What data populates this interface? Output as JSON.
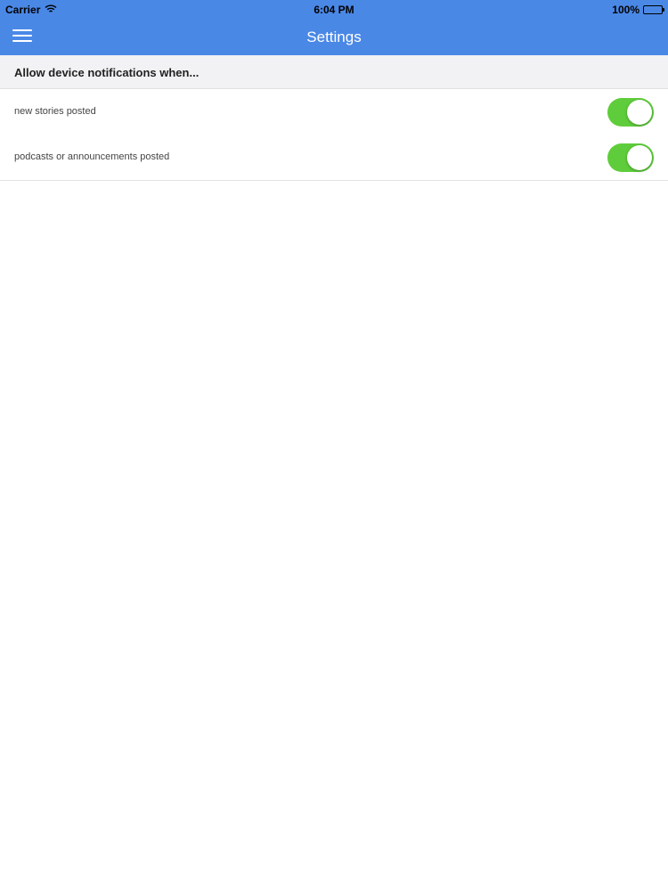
{
  "status_bar": {
    "carrier": "Carrier",
    "time": "6:04 PM",
    "battery": "100%",
    "battery_level": 1.0,
    "wifi_icon": "wifi-icon"
  },
  "nav": {
    "title": "Settings",
    "menu_icon": "hamburger-menu-icon"
  },
  "section": {
    "header": "Allow device notifications when..."
  },
  "settings": [
    {
      "label": "new stories posted",
      "enabled": true
    },
    {
      "label": "podcasts or announcements posted",
      "enabled": true
    }
  ],
  "colors": {
    "header_blue": "#4a88e6",
    "toggle_on": "#5fcd3b",
    "section_bg": "#f2f2f4"
  }
}
